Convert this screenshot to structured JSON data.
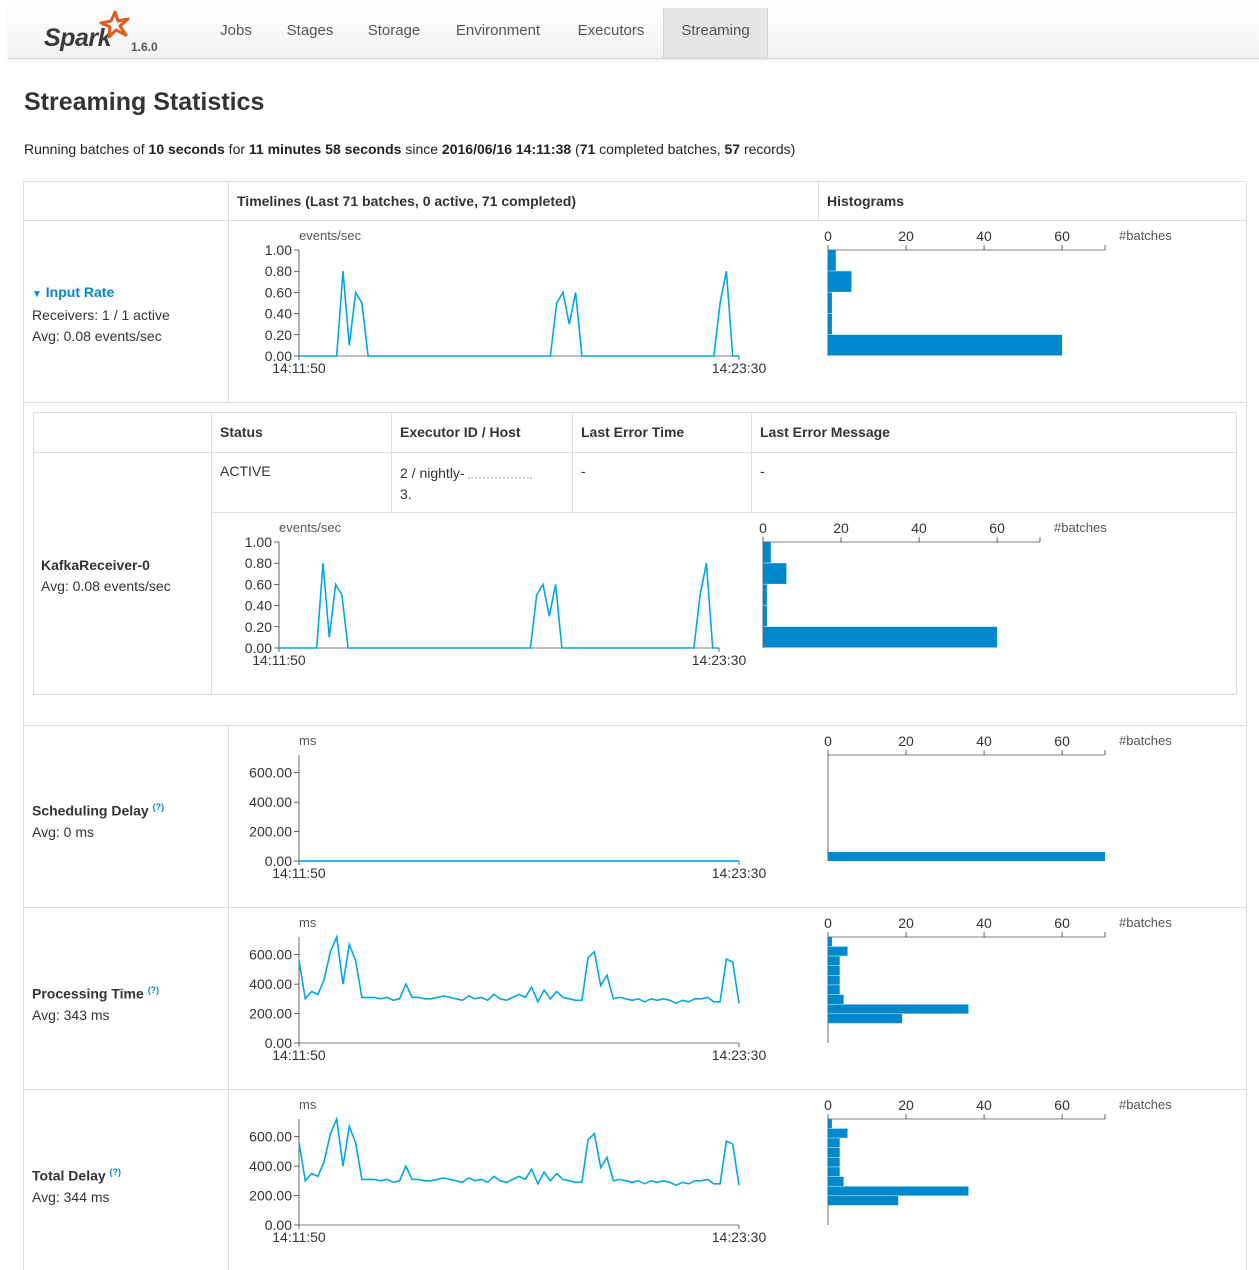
{
  "navbar": {
    "brand": "Spark",
    "version": "1.6.0",
    "tabs": [
      "Jobs",
      "Stages",
      "Storage",
      "Environment",
      "Executors",
      "Streaming"
    ],
    "active_tab": "Streaming"
  },
  "page_title": "Streaming Statistics",
  "summary": {
    "prefix": "Running batches of ",
    "batch_interval": "10 seconds",
    "for_text": " for ",
    "duration": "11 minutes 58 seconds",
    "since_text": " since ",
    "start_time": "2016/06/16 14:11:38",
    "open_paren": " (",
    "completed_batches": "71",
    "completed_text": " completed batches, ",
    "records": "57",
    "records_text": " records)"
  },
  "table": {
    "timelines_header": "Timelines (Last 71 batches, 0 active, 71 completed)",
    "histograms_header": "Histograms"
  },
  "input_rate": {
    "title": "Input Rate",
    "receivers": "Receivers: 1 / 1 active",
    "avg": "Avg: 0.08 events/sec"
  },
  "receiver_table": {
    "headers": [
      "Status",
      "Executor ID / Host",
      "Last Error Time",
      "Last Error Message"
    ],
    "row": {
      "status": "ACTIVE",
      "executor_line1": "2 / nightly-",
      "executor_line2": "3.",
      "last_error_time": "-",
      "last_error_message": "-"
    },
    "receiver_name": "KafkaReceiver-0",
    "receiver_avg": "Avg: 0.08 events/sec"
  },
  "scheduling_delay": {
    "title": "Scheduling Delay",
    "help": "(?)",
    "avg": "Avg: 0 ms"
  },
  "processing_time": {
    "title": "Processing Time",
    "help": "(?)",
    "avg": "Avg: 343 ms"
  },
  "total_delay": {
    "title": "Total Delay",
    "help": "(?)",
    "avg": "Avg: 344 ms"
  },
  "chart_data": [
    {
      "id": "input_rate",
      "type": "line",
      "unit": "events/sec",
      "x_labels": [
        "14:11:50",
        "14:23:30"
      ],
      "yticks": [
        "0.00",
        "0.20",
        "0.40",
        "0.60",
        "0.80",
        "1.00"
      ],
      "ylim": [
        0,
        1
      ],
      "values": [
        0,
        0,
        0,
        0,
        0,
        0,
        0,
        0.8,
        0.1,
        0.6,
        0.5,
        0,
        0,
        0,
        0,
        0,
        0,
        0,
        0,
        0,
        0,
        0,
        0,
        0,
        0,
        0,
        0,
        0,
        0,
        0,
        0,
        0,
        0,
        0,
        0,
        0,
        0,
        0,
        0,
        0,
        0,
        0.5,
        0.6,
        0.3,
        0.6,
        0,
        0,
        0,
        0,
        0,
        0,
        0,
        0,
        0,
        0,
        0,
        0,
        0,
        0,
        0,
        0,
        0,
        0,
        0,
        0,
        0,
        0,
        0.5,
        0.8,
        0,
        0
      ],
      "color": "#00a8e0"
    },
    {
      "id": "input_rate_hist",
      "type": "bar",
      "orientation": "horizontal",
      "xlabel": "#batches",
      "xticks": [
        "0",
        "20",
        "40",
        "60"
      ],
      "xlim": [
        0,
        71
      ],
      "bins": [
        0.8,
        0.6,
        0.4,
        0.2,
        0.0
      ],
      "values": [
        2,
        6,
        1,
        1,
        60
      ],
      "color": "#0088cc"
    },
    {
      "id": "kafka_receiver",
      "type": "line",
      "unit": "events/sec",
      "x_labels": [
        "14:11:50",
        "14:23:30"
      ],
      "yticks": [
        "0.00",
        "0.20",
        "0.40",
        "0.60",
        "0.80",
        "1.00"
      ],
      "ylim": [
        0,
        1
      ],
      "values": [
        0,
        0,
        0,
        0,
        0,
        0,
        0,
        0.8,
        0.1,
        0.6,
        0.5,
        0,
        0,
        0,
        0,
        0,
        0,
        0,
        0,
        0,
        0,
        0,
        0,
        0,
        0,
        0,
        0,
        0,
        0,
        0,
        0,
        0,
        0,
        0,
        0,
        0,
        0,
        0,
        0,
        0,
        0,
        0.5,
        0.6,
        0.3,
        0.6,
        0,
        0,
        0,
        0,
        0,
        0,
        0,
        0,
        0,
        0,
        0,
        0,
        0,
        0,
        0,
        0,
        0,
        0,
        0,
        0,
        0,
        0,
        0.5,
        0.8,
        0,
        0
      ],
      "color": "#00a8e0"
    },
    {
      "id": "kafka_receiver_hist",
      "type": "bar",
      "orientation": "horizontal",
      "xlabel": "#batches",
      "xticks": [
        "0",
        "20",
        "40",
        "60"
      ],
      "xlim": [
        0,
        71
      ],
      "bins": [
        0.8,
        0.6,
        0.4,
        0.2,
        0.0
      ],
      "values": [
        2,
        6,
        1,
        1,
        60
      ],
      "color": "#0088cc"
    },
    {
      "id": "scheduling_delay",
      "type": "line",
      "unit": "ms",
      "x_labels": [
        "14:11:50",
        "14:23:30"
      ],
      "yticks": [
        "0.00",
        "200.00",
        "400.00",
        "600.00"
      ],
      "ylim": [
        0,
        720
      ],
      "values": [
        1,
        1,
        1,
        1,
        1,
        1,
        1,
        1,
        1,
        1,
        1,
        1,
        1,
        1,
        1,
        1,
        1,
        1,
        1,
        1,
        1,
        1,
        1,
        1,
        1,
        1,
        1,
        1,
        1,
        1,
        1,
        1,
        1,
        1,
        1,
        1,
        1,
        1,
        1,
        1,
        1,
        1,
        1,
        1,
        1,
        1,
        1,
        1,
        1,
        1,
        1,
        1,
        1,
        1,
        1,
        1,
        1,
        1,
        1,
        1,
        1,
        1,
        1,
        1,
        1,
        1,
        1,
        1,
        1,
        1,
        1
      ],
      "color": "#00a8e0"
    },
    {
      "id": "scheduling_delay_hist",
      "type": "bar",
      "orientation": "horizontal",
      "xlabel": "#batches",
      "xticks": [
        "0",
        "20",
        "40",
        "60"
      ],
      "xlim": [
        0,
        71
      ],
      "bins": [
        0
      ],
      "values": [
        71
      ],
      "color": "#0088cc"
    },
    {
      "id": "processing_time",
      "type": "line",
      "unit": "ms",
      "x_labels": [
        "14:11:50",
        "14:23:30"
      ],
      "yticks": [
        "0.00",
        "200.00",
        "400.00",
        "600.00"
      ],
      "ylim": [
        0,
        720
      ],
      "values": [
        560,
        300,
        350,
        330,
        430,
        620,
        720,
        400,
        670,
        560,
        310,
        310,
        310,
        300,
        310,
        290,
        300,
        400,
        310,
        310,
        300,
        300,
        310,
        320,
        310,
        300,
        290,
        320,
        300,
        310,
        290,
        330,
        300,
        290,
        310,
        330,
        310,
        380,
        280,
        360,
        300,
        350,
        310,
        300,
        290,
        290,
        580,
        620,
        390,
        460,
        300,
        310,
        300,
        290,
        300,
        280,
        300,
        290,
        300,
        290,
        270,
        290,
        280,
        300,
        300,
        310,
        280,
        280,
        570,
        550,
        270
      ],
      "color": "#00a8e0"
    },
    {
      "id": "processing_time_hist",
      "type": "bar",
      "orientation": "horizontal",
      "xlabel": "#batches",
      "xticks": [
        "0",
        "20",
        "40",
        "60"
      ],
      "xlim": [
        0,
        71
      ],
      "bins": [
        720,
        670,
        620,
        570,
        520,
        470,
        420,
        370,
        320,
        270,
        220
      ],
      "values": [
        1,
        5,
        3,
        3,
        3,
        3,
        4,
        36,
        19,
        0,
        0
      ],
      "color": "#0088cc"
    },
    {
      "id": "total_delay",
      "type": "line",
      "unit": "ms",
      "x_labels": [
        "14:11:50",
        "14:23:30"
      ],
      "yticks": [
        "0.00",
        "200.00",
        "400.00",
        "600.00"
      ],
      "ylim": [
        0,
        720
      ],
      "values": [
        560,
        300,
        350,
        330,
        430,
        620,
        720,
        400,
        670,
        560,
        310,
        310,
        310,
        300,
        310,
        290,
        300,
        400,
        310,
        310,
        300,
        300,
        310,
        320,
        310,
        300,
        290,
        320,
        300,
        310,
        290,
        330,
        300,
        290,
        310,
        330,
        310,
        380,
        280,
        360,
        300,
        350,
        310,
        300,
        290,
        290,
        580,
        620,
        390,
        460,
        300,
        310,
        300,
        290,
        300,
        280,
        300,
        290,
        300,
        290,
        270,
        290,
        280,
        300,
        300,
        310,
        280,
        280,
        570,
        550,
        270
      ],
      "color": "#00a8e0"
    },
    {
      "id": "total_delay_hist",
      "type": "bar",
      "orientation": "horizontal",
      "xlabel": "#batches",
      "xticks": [
        "0",
        "20",
        "40",
        "60"
      ],
      "xlim": [
        0,
        71
      ],
      "bins": [
        720,
        670,
        620,
        570,
        520,
        470,
        420,
        370,
        320,
        270,
        220
      ],
      "values": [
        1,
        5,
        3,
        3,
        3,
        3,
        4,
        36,
        18,
        0,
        0
      ],
      "color": "#0088cc"
    }
  ]
}
